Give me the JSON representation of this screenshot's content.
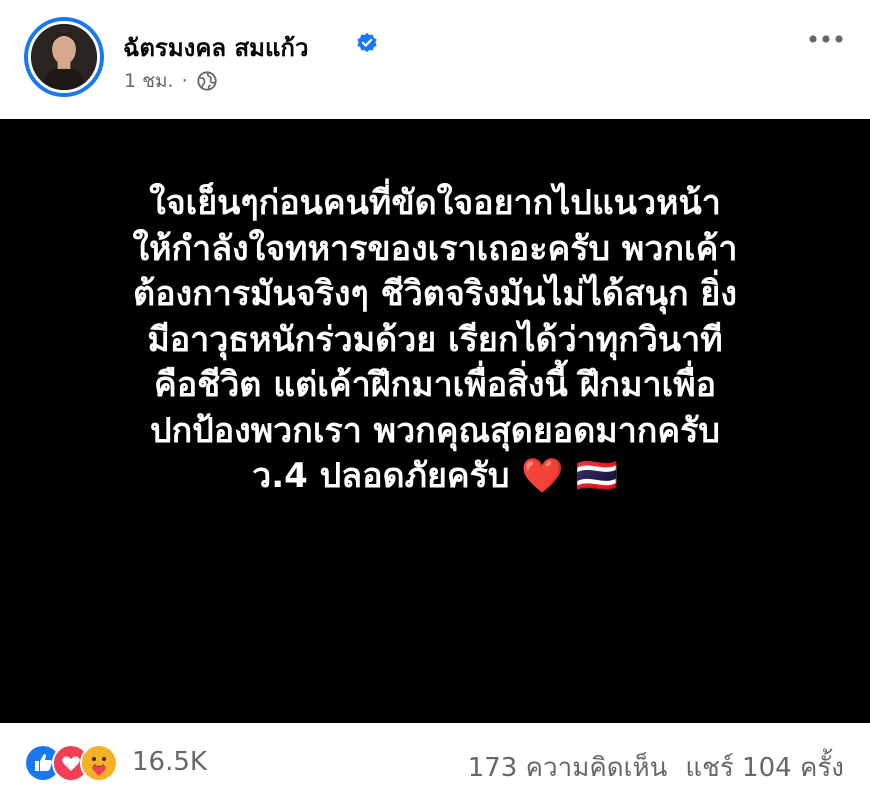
{
  "post": {
    "author_name": "ฉัตรมงคล สมแก้ว",
    "time": "1 ชม.",
    "separator": "·",
    "text_lines": [
      "ใจเย็นๆก่อนคนที่ขัดใจอยากไปแนวหน้า",
      "ให้กำลังใจทหารของเราเถอะครับ พวกเค้า",
      "ต้องการมันจริงๆ ชีวิตจริงมันไม่ได้สนุก ยิ่ง",
      "มีอาวุธหนักร่วมด้วย เรียกได้ว่าทุกวินาที",
      "คือชีวิต แต่เค้าฝึกมาเพื่อสิ่งนี้ ฝึกมาเพื่อ",
      "ปกป้องพวกเรา พวกคุณสุดยอดมากครับ",
      "ว.4 ปลอดภัยครับ ❤️ 🇹🇭"
    ]
  },
  "engagement": {
    "reaction_count": "16.5K",
    "comments": "173 ความคิดเห็น",
    "shares": "แชร์ 104 ครั้ง"
  },
  "icons": {
    "verified": "verified-badge-icon",
    "audience": "globe-icon",
    "more": "more-options-icon",
    "reactions": [
      "like-reaction-icon",
      "love-reaction-icon",
      "care-reaction-icon"
    ]
  },
  "colors": {
    "accent": "#1877f2",
    "post_background": "#000000",
    "secondary_text": "#65676b"
  }
}
